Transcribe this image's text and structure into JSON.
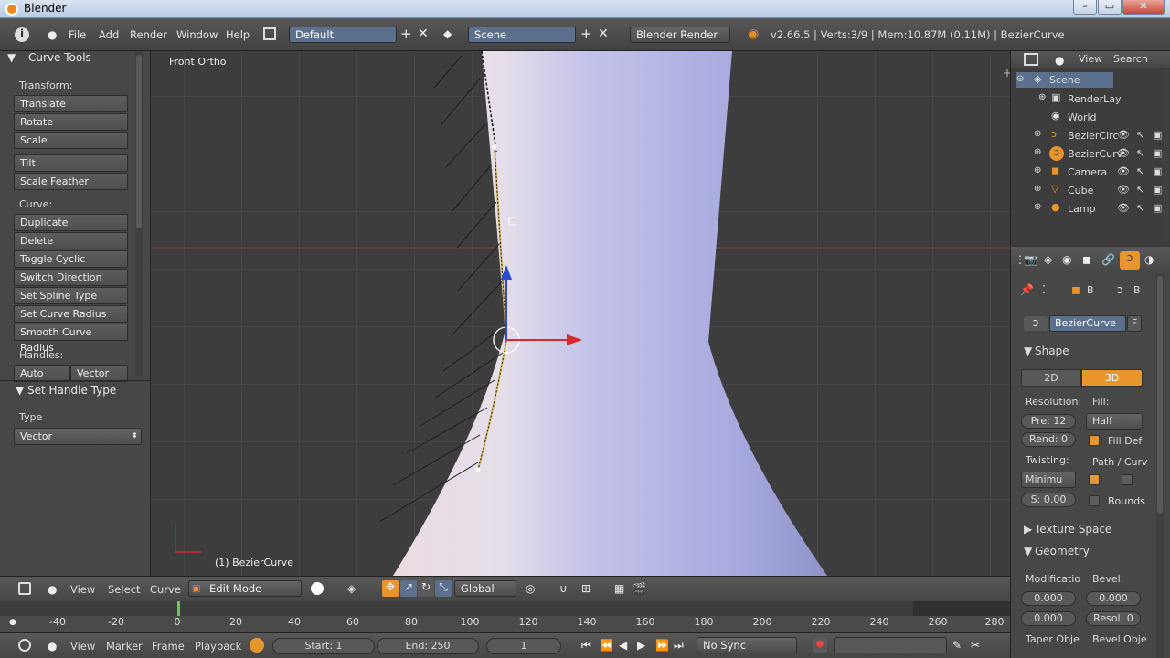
{
  "window": {
    "title": "Blender",
    "btn_min": "–",
    "btn_max": "▭",
    "btn_close": "✕"
  },
  "topbar": {
    "menus": [
      "File",
      "Add",
      "Render",
      "Window",
      "Help"
    ],
    "layout": "Default",
    "scene": "Scene",
    "engine": "Blender Render",
    "stats": "v2.66.5 | Verts:3/9 | Mem:10.87M (0.11M) | BezierCurve"
  },
  "tools": {
    "title": "Curve Tools",
    "transform_label": "Transform:",
    "transform": [
      "Translate",
      "Rotate",
      "Scale"
    ],
    "extra": [
      "Tilt",
      "Scale Feather"
    ],
    "curve_label": "Curve:",
    "curve": [
      "Duplicate",
      "Delete",
      "Toggle Cyclic",
      "Switch Direction",
      "Set Spline Type",
      "Set Curve Radius",
      "Smooth Curve Radius"
    ],
    "handles_label": "Handles:",
    "handles": [
      "Auto",
      "Vector"
    ],
    "op_title": "Set Handle Type",
    "type_label": "Type",
    "type_value": "Vector"
  },
  "viewport": {
    "view_name": "Front Ortho",
    "object_name": "(1) BezierCurve"
  },
  "viewbar": {
    "menus": [
      "View",
      "Select",
      "Curve"
    ],
    "mode": "Edit Mode",
    "orientation": "Global"
  },
  "timeline": {
    "ticks": [
      "-40",
      "-20",
      "0",
      "20",
      "40",
      "60",
      "80",
      "100",
      "120",
      "140",
      "160",
      "180",
      "200",
      "220",
      "240",
      "260",
      "280"
    ],
    "current": 0
  },
  "playbar": {
    "menus": [
      "View",
      "Marker",
      "Frame",
      "Playback"
    ],
    "start": "Start: 1",
    "end": "End: 250",
    "frame": "1",
    "sync": "No Sync"
  },
  "outliner": {
    "menus": [
      "View",
      "Search"
    ],
    "items": [
      "Scene",
      "RenderLay",
      "World",
      "BezierCirc",
      "BezierCurv",
      "Camera",
      "Cube",
      "Lamp"
    ]
  },
  "properties": {
    "ctx_a": "B",
    "ctx_b": "B",
    "datablock": "BezierCurve",
    "fake": "F",
    "shape": "Shape",
    "btn_2d": "2D",
    "btn_3d": "3D",
    "resolution_label": "Resolution:",
    "fill_label": "Fill:",
    "pre": "Pre: 12",
    "fill": "Half",
    "rend": "Rend: 0",
    "fill_deform": "Fill Def",
    "twisting_label": "Twisting:",
    "path_label": "Path / Curv",
    "twist": "Minimu",
    "smooth": "S: 0.00",
    "bounds": "Bounds",
    "texture_space": "Texture Space",
    "geometry": "Geometry",
    "modification_label": "Modificatio",
    "bevel_label": "Bevel:",
    "offset": "0.000",
    "depth": "0.000",
    "extrude": "0.000",
    "resol": "Resol: 0",
    "taper_label": "Taper Obje",
    "bevel_obj_label": "Bevel Obje"
  },
  "colors": {
    "accent": "#e8952d",
    "selected": "#5a708c"
  }
}
